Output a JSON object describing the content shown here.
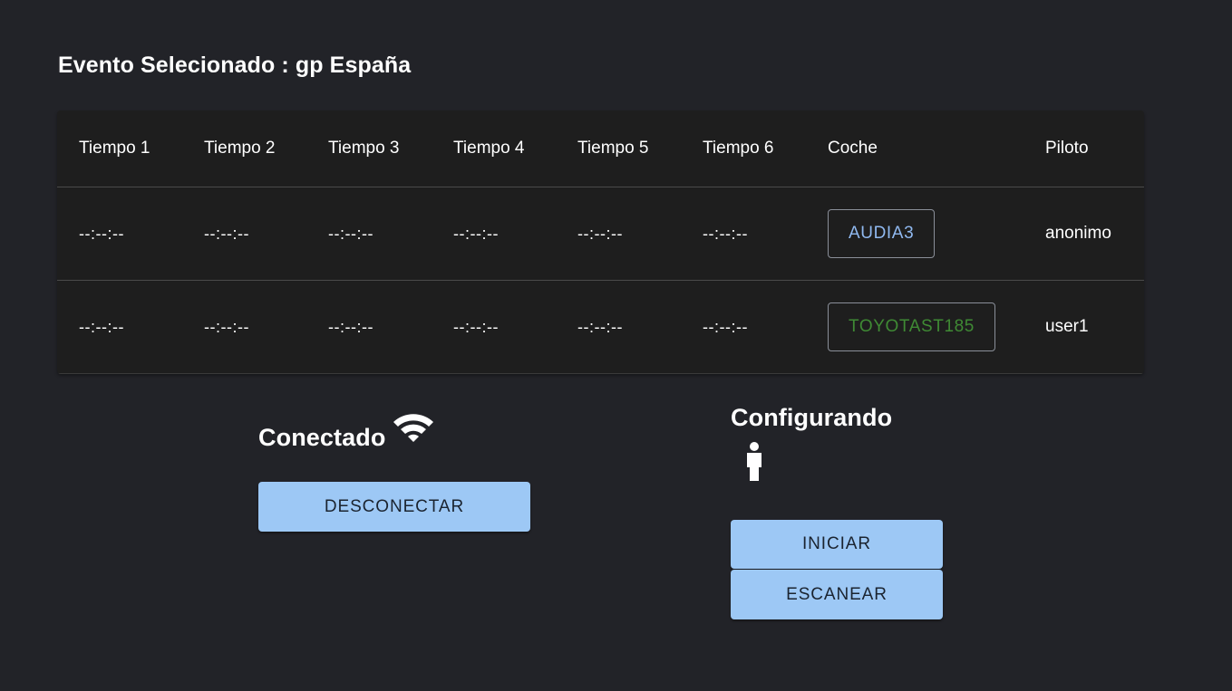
{
  "header": {
    "title": "Evento Selecionado : gp España"
  },
  "table": {
    "columns": [
      "Tiempo 1",
      "Tiempo 2",
      "Tiempo 3",
      "Tiempo 4",
      "Tiempo 5",
      "Tiempo 6",
      "Coche",
      "Piloto"
    ],
    "rows": [
      {
        "times": [
          "--:--:--",
          "--:--:--",
          "--:--:--",
          "--:--:--",
          "--:--:--",
          "--:--:--"
        ],
        "car": "AUDIA3",
        "car_color": "#90b9f0",
        "pilot": "anonimo"
      },
      {
        "times": [
          "--:--:--",
          "--:--:--",
          "--:--:--",
          "--:--:--",
          "--:--:--",
          "--:--:--"
        ],
        "car": "TOYOTAST185",
        "car_color": "#3f8a34",
        "pilot": "user1"
      }
    ]
  },
  "connection": {
    "status": "Conectado",
    "icon": "wifi-icon",
    "disconnect_label": "DESCONECTAR"
  },
  "config": {
    "status": "Configurando",
    "icon": "person-icon",
    "start_label": "INICIAR",
    "scan_label": "ESCANEAR"
  },
  "colors": {
    "background": "#222328",
    "table_bg": "#1e1e1e",
    "button_bg": "#9dc8f5"
  }
}
